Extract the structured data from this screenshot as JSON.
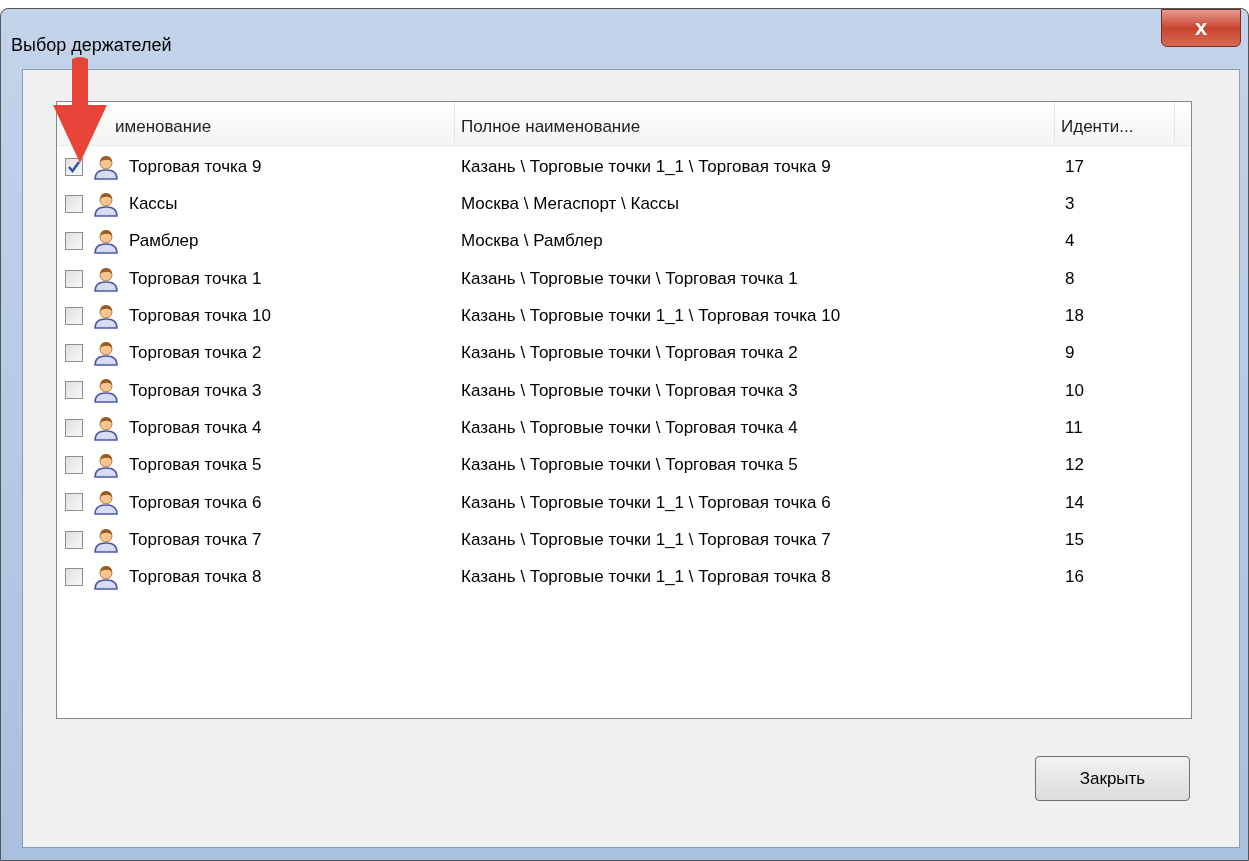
{
  "window": {
    "title": "Выбор держателей",
    "close_label": "x"
  },
  "table": {
    "columns": [
      "именование",
      "Полное наименование",
      "Иденти..."
    ],
    "rows": [
      {
        "name": "Торговая точка 9",
        "full_name": "Казань \\ Торговые точки 1_1 \\ Торговая точка 9",
        "id": "17",
        "checked": true
      },
      {
        "name": "Кассы",
        "full_name": "Москва \\ Мегаспорт \\ Кассы",
        "id": "3",
        "checked": false
      },
      {
        "name": "Рамблер",
        "full_name": "Москва \\ Рамблер",
        "id": "4",
        "checked": false
      },
      {
        "name": "Торговая точка 1",
        "full_name": "Казань \\ Торговые точки \\ Торговая точка 1",
        "id": "8",
        "checked": false
      },
      {
        "name": "Торговая точка 10",
        "full_name": "Казань \\ Торговые точки 1_1 \\ Торговая точка 10",
        "id": "18",
        "checked": false
      },
      {
        "name": "Торговая точка 2",
        "full_name": "Казань \\ Торговые точки \\ Торговая точка 2",
        "id": "9",
        "checked": false
      },
      {
        "name": "Торговая точка 3",
        "full_name": "Казань \\ Торговые точки \\ Торговая точка 3",
        "id": "10",
        "checked": false
      },
      {
        "name": "Торговая точка 4",
        "full_name": "Казань \\ Торговые точки \\ Торговая точка 4",
        "id": "11",
        "checked": false
      },
      {
        "name": "Торговая точка 5",
        "full_name": "Казань \\ Торговые точки \\ Торговая точка 5",
        "id": "12",
        "checked": false
      },
      {
        "name": "Торговая точка 6",
        "full_name": "Казань \\ Торговые точки 1_1 \\ Торговая точка 6",
        "id": "14",
        "checked": false
      },
      {
        "name": "Торговая точка 7",
        "full_name": "Казань \\ Торговые точки 1_1 \\ Торговая точка 7",
        "id": "15",
        "checked": false
      },
      {
        "name": "Торговая точка 8",
        "full_name": "Казань \\ Торговые точки 1_1 \\ Торговая точка 8",
        "id": "16",
        "checked": false
      }
    ]
  },
  "buttons": [
    "Закрыть"
  ]
}
